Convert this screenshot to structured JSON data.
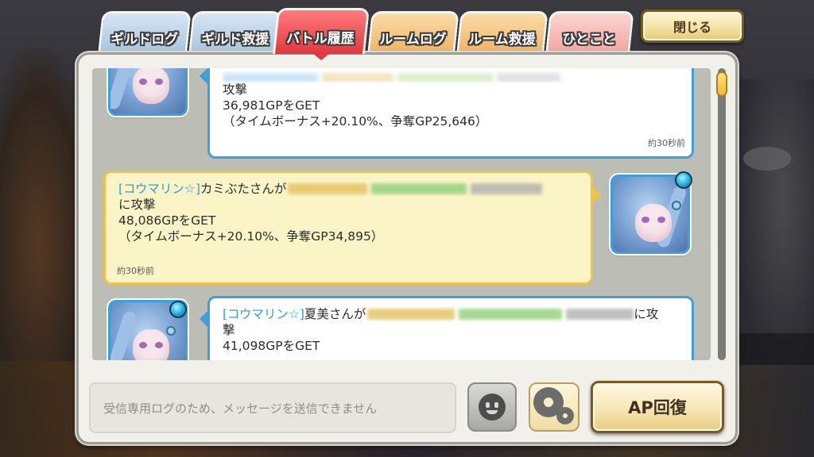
{
  "tabs": [
    {
      "label": "ギルドログ",
      "active": false
    },
    {
      "label": "ギルド救援",
      "active": false
    },
    {
      "label": "バトル履歴",
      "active": true
    },
    {
      "label": "ルームログ",
      "active": false
    },
    {
      "label": "ルーム救援",
      "active": false
    },
    {
      "label": "ひとこと",
      "active": false
    }
  ],
  "close_label": "閉じる",
  "messages": [
    {
      "side": "left",
      "style": "white",
      "lines": [
        "攻撃",
        "36,981GPをGET",
        "（タイムボーナス+20.10%、争奪GP25,646）"
      ],
      "time": "約30秒前"
    },
    {
      "side": "right",
      "style": "yellow",
      "name": "[コウマリン☆]",
      "attacker": "カミぶたさんが",
      "lines": [
        "に攻撃",
        "48,086GPをGET",
        "（タイムボーナス+20.10%、争奪GP34,895）"
      ],
      "time": "約30秒前"
    },
    {
      "side": "left",
      "style": "white",
      "name": "[コウマリン☆]",
      "attacker": "夏美さんが",
      "tail": "に攻",
      "lines": [
        "撃",
        "41,098GPをGET"
      ]
    }
  ],
  "input_placeholder": "受信専用ログのため、メッセージを送信できません",
  "icons": {
    "stamp": "face-icon",
    "settings": "gear-icon"
  },
  "ap_button_label": "AP回復",
  "colors": {
    "active_tab": "#e2383f",
    "blue_tab": "#a9c4de",
    "orange_tab": "#f0b366",
    "pink_tab": "#f2a7a0",
    "name_link": "#2a9ed6",
    "own_bubble": "#fbf4c7",
    "other_bubble": "#ffffff"
  }
}
